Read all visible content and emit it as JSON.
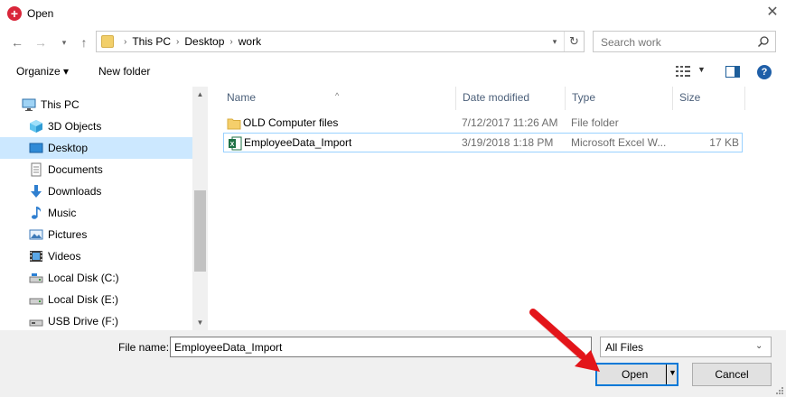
{
  "window": {
    "title": "Open"
  },
  "address": {
    "crumbs": [
      "This PC",
      "Desktop",
      "work"
    ]
  },
  "search": {
    "placeholder": "Search work"
  },
  "toolbar": {
    "organize_label": "Organize ▾",
    "new_folder_label": "New folder"
  },
  "sidebar": {
    "items": [
      {
        "label": "This PC",
        "icon": "pc-icon"
      },
      {
        "label": "3D Objects",
        "icon": "cube-icon"
      },
      {
        "label": "Desktop",
        "icon": "desktop-icon"
      },
      {
        "label": "Documents",
        "icon": "documents-icon"
      },
      {
        "label": "Downloads",
        "icon": "downloads-icon"
      },
      {
        "label": "Music",
        "icon": "music-icon"
      },
      {
        "label": "Pictures",
        "icon": "pictures-icon"
      },
      {
        "label": "Videos",
        "icon": "videos-icon"
      },
      {
        "label": "Local Disk (C:)",
        "icon": "drive-icon"
      },
      {
        "label": "Local Disk (E:)",
        "icon": "drive-icon"
      },
      {
        "label": "USB Drive (F:)",
        "icon": "usb-drive-icon"
      }
    ]
  },
  "columns": {
    "name": "Name",
    "date": "Date modified",
    "type": "Type",
    "size": "Size"
  },
  "files": [
    {
      "name": "OLD Computer files",
      "date": "7/12/2017 11:26 AM",
      "type": "File folder",
      "size": "",
      "icon": "folder-icon"
    },
    {
      "name": "EmployeeData_Import",
      "date": "3/19/2018 1:18 PM",
      "type": "Microsoft Excel W...",
      "size": "17 KB",
      "icon": "excel-icon"
    }
  ],
  "footer": {
    "filename_label": "File name:",
    "filename_value": "EmployeeData_Import",
    "filter_value": "All Files",
    "open_label": "Open",
    "cancel_label": "Cancel"
  },
  "colors": {
    "accent": "#0078d7",
    "selection": "#cce8ff",
    "arrow": "#e3151a"
  }
}
